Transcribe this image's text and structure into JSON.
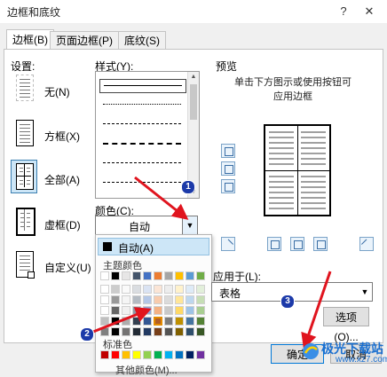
{
  "window": {
    "title": "边框和底纹",
    "help_icon": "?",
    "close_icon": "✕"
  },
  "tabs": [
    {
      "label": "边框(B)",
      "active": true
    },
    {
      "label": "页面边框(P)",
      "active": false
    },
    {
      "label": "底纹(S)",
      "active": false
    }
  ],
  "settings": {
    "label": "设置:",
    "items": [
      {
        "label": "无(N)",
        "selected": false
      },
      {
        "label": "方框(X)",
        "selected": false
      },
      {
        "label": "全部(A)",
        "selected": true
      },
      {
        "label": "虚框(D)",
        "selected": false
      },
      {
        "label": "自定义(U)",
        "selected": false
      }
    ]
  },
  "style": {
    "label": "样式(Y):",
    "options": [
      "solid",
      "dotted",
      "dashed-fine",
      "dashed",
      "dashed-long",
      "dash-dot"
    ],
    "selected": "solid"
  },
  "color": {
    "label": "颜色(C):",
    "value": "自动"
  },
  "palette": {
    "auto_label": "自动(A)",
    "theme_heading": "主题颜色",
    "theme_colors": [
      "#ffffff",
      "#000000",
      "#e7e6e6",
      "#44546a",
      "#4472c4",
      "#ed7d31",
      "#a5a5a5",
      "#ffc000",
      "#5b9bd5",
      "#70ad47"
    ],
    "standard_heading": "标准色",
    "standard_colors": [
      "#c00000",
      "#ff0000",
      "#ffc000",
      "#ffff00",
      "#92d050",
      "#00b050",
      "#00b0f0",
      "#0070c0",
      "#002060",
      "#7030a0"
    ],
    "more_label": "其他颜色(M)..."
  },
  "preview": {
    "label": "预览",
    "hint_line1": "单击下方图示或使用按钮可",
    "hint_line2": "应用边框"
  },
  "apply": {
    "label": "应用于(L):",
    "value": "表格"
  },
  "buttons": {
    "options": "选项(O)...",
    "ok": "确定",
    "cancel": "取消"
  },
  "annotations": {
    "step1": "1",
    "step2": "2",
    "step3": "3"
  },
  "watermark": {
    "text": "极光下载站",
    "url": "www.xz7.com"
  },
  "colors": {
    "badge": "#1c3aa9",
    "arrow": "#e0141e",
    "selection": "#cde6f7"
  }
}
